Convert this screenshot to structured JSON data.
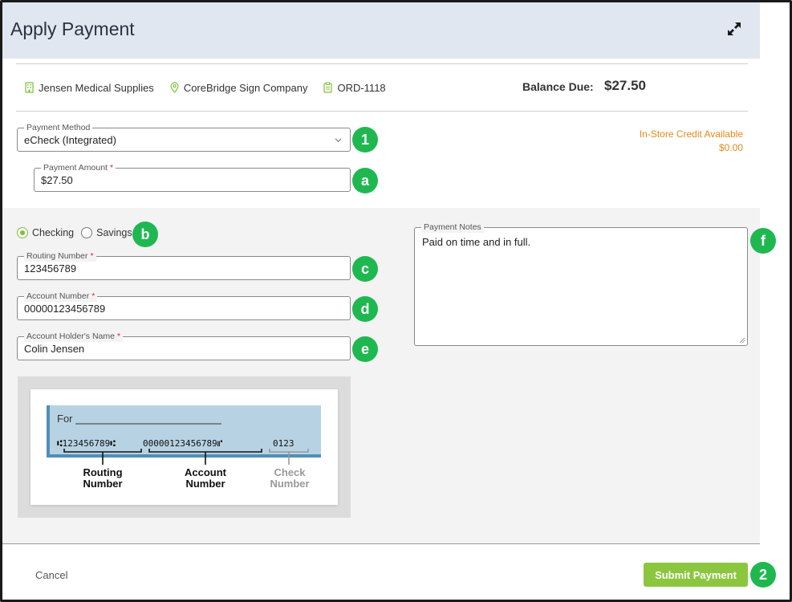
{
  "header": {
    "title": "Apply Payment"
  },
  "info": {
    "company": "Jensen Medical Supplies",
    "location": "CoreBridge Sign Company",
    "order": "ORD-1118",
    "balance_label": "Balance Due:",
    "balance_value": "$27.50"
  },
  "payment_method": {
    "label": "Payment Method",
    "value": "eCheck (Integrated)"
  },
  "payment_amount": {
    "label": "Payment Amount",
    "value": "$27.50"
  },
  "credit": {
    "label": "In-Store Credit Available",
    "value": "$0.00"
  },
  "account_type": {
    "checking": "Checking",
    "savings": "Savings",
    "selected": "Checking"
  },
  "routing": {
    "label": "Routing Number",
    "value": "123456789"
  },
  "account": {
    "label": "Account Number",
    "value": "00000123456789"
  },
  "holder": {
    "label": "Account Holder's Name",
    "value": "Colin Jensen"
  },
  "notes": {
    "label": "Payment Notes",
    "value": "Paid on time and in full."
  },
  "check_image": {
    "for_label": "For",
    "micr_routing": "⑆123456789⑆",
    "micr_account": "00000123456789⑈",
    "micr_check": "0123",
    "routing_caption_1": "Routing",
    "routing_caption_2": "Number",
    "account_caption_1": "Account",
    "account_caption_2": "Number",
    "check_caption_1": "Check",
    "check_caption_2": "Number"
  },
  "badges": {
    "b1": "1",
    "ba": "a",
    "bb": "b",
    "bc": "c",
    "bd": "d",
    "be": "e",
    "bf": "f",
    "b2": "2"
  },
  "footer": {
    "cancel": "Cancel",
    "submit": "Submit Payment"
  },
  "colors": {
    "header_bg": "#e0e7f0",
    "badge": "#1fb850",
    "submit": "#8cc63f",
    "credit": "#e48a1a",
    "required": "#e02424"
  }
}
